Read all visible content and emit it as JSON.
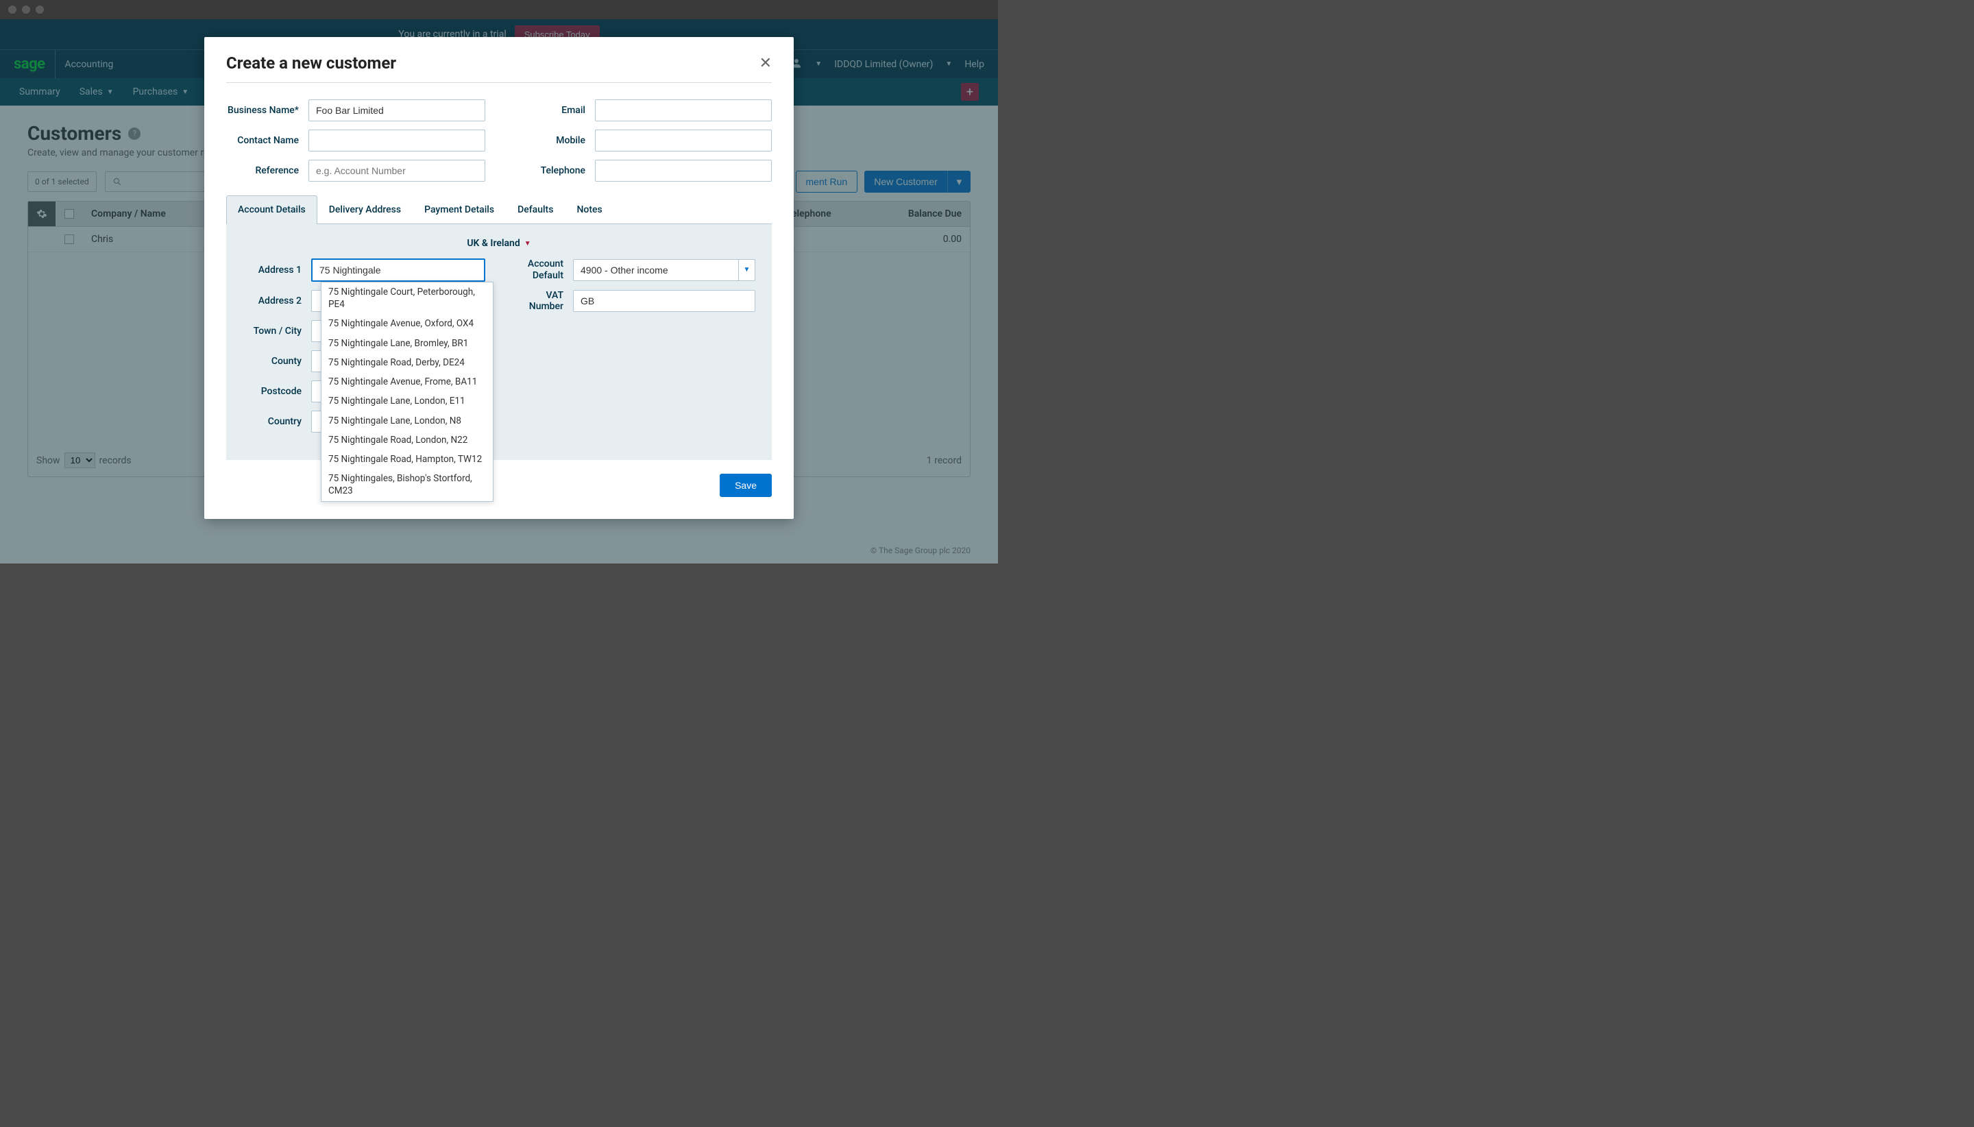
{
  "trial": {
    "text": "You are currently in a trial",
    "subscribe": "Subscribe Today"
  },
  "nav": {
    "logo": "sage",
    "app_name": "Accounting",
    "owner": "IDDQD Limited (Owner)",
    "help": "Help"
  },
  "subnav": {
    "summary": "Summary",
    "sales": "Sales",
    "purchases": "Purchases"
  },
  "page": {
    "title": "Customers",
    "subtitle": "Create, view and manage your customer records.",
    "selected": "0 of 1 selected",
    "payment_run": "ment Run",
    "new_customer": "New Customer"
  },
  "table": {
    "th_company": "Company / Name",
    "th_telephone": "Telephone",
    "th_balance": "Balance Due",
    "row1_name": "Chris",
    "row1_balance": "0.00",
    "show": "Show",
    "records": "records",
    "select_val": "10",
    "count": "1 record"
  },
  "modal": {
    "title": "Create a new customer",
    "lbl_business": "Business Name*",
    "lbl_contact": "Contact Name",
    "lbl_reference": "Reference",
    "lbl_email": "Email",
    "lbl_mobile": "Mobile",
    "lbl_telephone": "Telephone",
    "val_business": "Foo Bar Limited",
    "ph_reference": "e.g. Account Number",
    "tabs": {
      "account": "Account Details",
      "delivery": "Delivery Address",
      "payment": "Payment Details",
      "defaults": "Defaults",
      "notes": "Notes"
    },
    "region": "UK & Ireland",
    "lbl_addr1": "Address 1",
    "lbl_addr2": "Address 2",
    "lbl_town": "Town / City",
    "lbl_county": "County",
    "lbl_postcode": "Postcode",
    "lbl_country": "Country",
    "val_addr1": "75 Nightingale",
    "lbl_account_default": "Account Default",
    "val_account_default": "4900 - Other income",
    "lbl_vat": "VAT Number",
    "val_vat": "GB",
    "save": "Save",
    "autocomplete": [
      "75 Nightingale Court, Peterborough, PE4",
      "75 Nightingale Avenue, Oxford, OX4",
      "75 Nightingale Lane, Bromley, BR1",
      "75 Nightingale Road, Derby, DE24",
      "75 Nightingale Avenue, Frome, BA11",
      "75 Nightingale Lane, London, E11",
      "75 Nightingale Lane, London, N8",
      "75 Nightingale Road, London, N22",
      "75 Nightingale Road, Hampton, TW12",
      "75 Nightingales, Bishop's Stortford, CM23"
    ]
  },
  "footer": "© The Sage Group plc 2020"
}
